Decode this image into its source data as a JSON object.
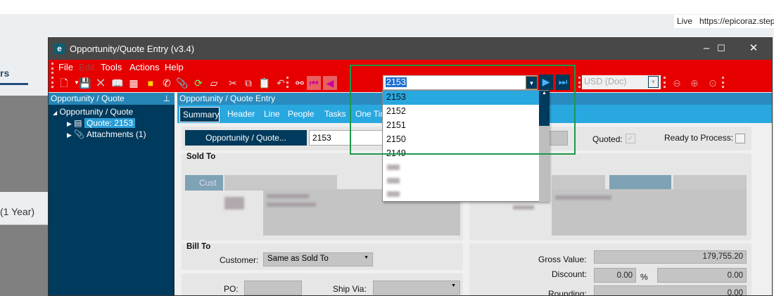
{
  "browser": {
    "live_label": "Live",
    "url": "https://epicoraz.steph"
  },
  "background": {
    "tab_fragment": "rs",
    "period": "(1 Year)"
  },
  "window": {
    "title": "Opportunity/Quote Entry (v3.4)",
    "logo": "e",
    "minimize": "–",
    "maximize": "☐",
    "close": "✕"
  },
  "menu": [
    "File",
    "Edit",
    "Tools",
    "Actions",
    "Help"
  ],
  "toolbar": {
    "icons": [
      "new-icon",
      "save-icon",
      "delete-icon",
      "open-book-icon",
      "calendar-icon",
      "note-icon",
      "phone-icon",
      "attachment-icon",
      "refresh-icon",
      "eraser-icon",
      "cut-icon",
      "copy-icon",
      "paste-icon",
      "undo-icon",
      "search-binoculars-icon"
    ],
    "record_value": "2153",
    "currency": "USD (Doc)"
  },
  "left_panel": {
    "title": "Opportunity / Quote",
    "tree": {
      "root": "Opportunity / Quote",
      "children": [
        "Quote: 2153",
        "Attachments (1)"
      ]
    }
  },
  "main": {
    "title": "Opportunity / Quote Entry",
    "tabs": [
      "Summary",
      "Header",
      "Line",
      "People",
      "Tasks",
      "One Tim"
    ],
    "opp_button": "Opportunity / Quote...",
    "opp_value": "2153",
    "quoted_label": "Quoted:",
    "ready_label": "Ready to Process:",
    "sold_to": "Sold To",
    "customer_btn": "Cust",
    "bill_to": "Bill To",
    "customer_label": "Customer:",
    "customer_value": "Same as Sold To",
    "po_label": "PO:",
    "ship_via_label": "Ship Via:",
    "gross_label": "Gross Value:",
    "gross_value": "179,755.20",
    "discount_label": "Discount:",
    "discount_pct": "0.00",
    "pct_sign": "%",
    "discount_value": "0.00",
    "rounding_label": "Rounding:",
    "rounding_value": "0.00"
  },
  "dropdown": {
    "items": [
      "2153",
      "2152",
      "2151",
      "2150",
      "2149"
    ],
    "selected": "2153"
  }
}
